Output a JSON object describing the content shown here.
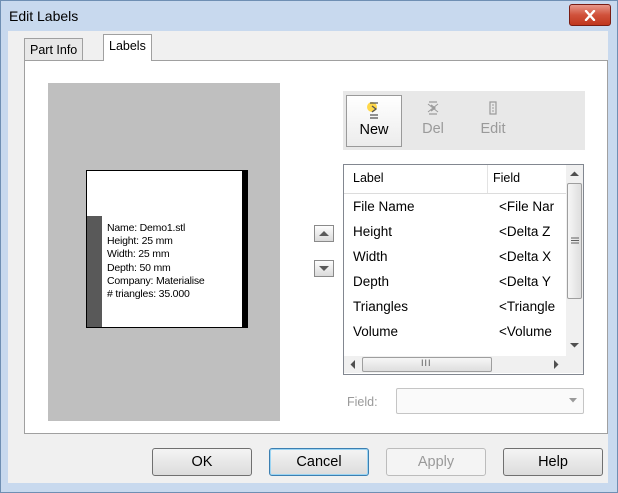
{
  "window": {
    "title": "Edit Labels"
  },
  "tabs": [
    {
      "label": "Part Info"
    },
    {
      "label": "Labels"
    }
  ],
  "preview": {
    "lines": [
      "Name: Demo1.stl",
      "Height: 25 mm",
      "Width: 25 mm",
      "Depth: 50 mm",
      "Company: Materialise",
      "# triangles: 35.000"
    ]
  },
  "toolbar": {
    "new_label": "New",
    "del_label": "Del",
    "edit_label": "Edit"
  },
  "list": {
    "columns": [
      "Label",
      "Field"
    ],
    "rows": [
      {
        "label": "File Name",
        "field": "<File Nar"
      },
      {
        "label": "Height",
        "field": "<Delta Z"
      },
      {
        "label": "Width",
        "field": "<Delta X"
      },
      {
        "label": "Depth",
        "field": "<Delta Y"
      },
      {
        "label": "Triangles",
        "field": "<Triangle"
      },
      {
        "label": "Volume",
        "field": "<Volume"
      }
    ],
    "hscroll_grip": "III"
  },
  "field": {
    "label": "Field:",
    "value": ""
  },
  "buttons": {
    "ok": "OK",
    "cancel": "Cancel",
    "apply": "Apply",
    "help": "Help"
  },
  "icons": {
    "close": "close-icon",
    "up": "arrow-up-icon",
    "down": "arrow-down-icon",
    "new": "new-label-icon",
    "del": "delete-label-icon",
    "edit": "edit-label-icon"
  },
  "colors": {
    "title_bar": "#c8d9ee",
    "close_button": "#d0513b",
    "preview_bg": "#bfbfbf"
  }
}
